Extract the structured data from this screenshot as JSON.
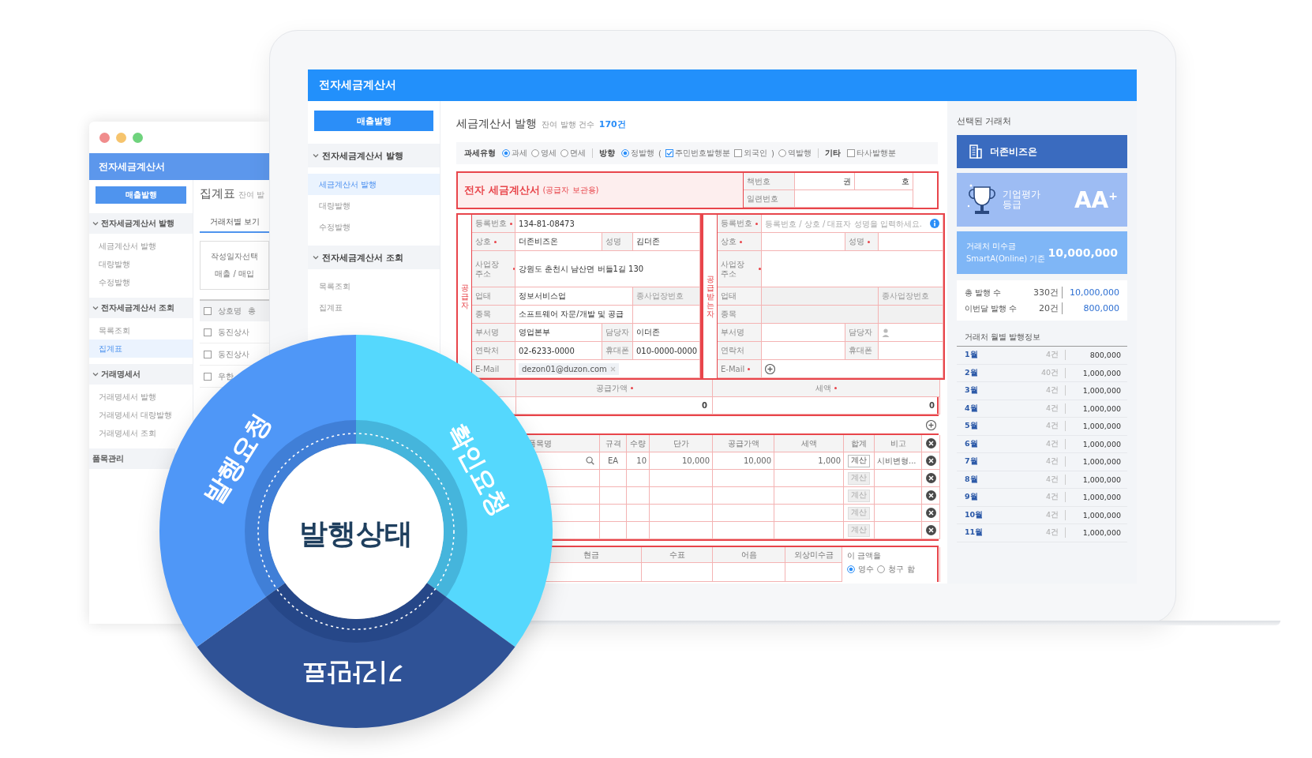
{
  "back_window": {
    "title": "전자세금계산서",
    "issue_button": "매출발행",
    "menu": [
      {
        "label": "전자세금계산서 발행",
        "expanded": true,
        "children": [
          {
            "label": "세금계산서 발행",
            "selected": false
          },
          {
            "label": "대량발행",
            "selected": false
          },
          {
            "label": "수정발행",
            "selected": false
          }
        ]
      },
      {
        "label": "전자세금계산서 조회",
        "expanded": true,
        "children": [
          {
            "label": "목록조회",
            "selected": false
          },
          {
            "label": "집계표",
            "selected": true
          }
        ]
      },
      {
        "label": "거래명세서",
        "expanded": true,
        "children": [
          {
            "label": "거래명세서 발행",
            "selected": false
          },
          {
            "label": "거래명세서 대량발행",
            "selected": false
          },
          {
            "label": "거래명세서 조회",
            "selected": false
          }
        ]
      },
      {
        "label": "품목관리"
      }
    ],
    "page_title": "집계표",
    "page_subtitle": "잔여 발",
    "tabs": [
      {
        "label": "거래처별 보기",
        "selected": true
      }
    ],
    "filter": [
      "작성일자선택",
      "매출 / 매입"
    ],
    "table": {
      "columns": [
        "상호명",
        "총"
      ],
      "header_checked": false,
      "rows": [
        {
          "checked": false,
          "name": "동진상사"
        },
        {
          "checked": false,
          "name": "동진상사"
        },
        {
          "checked": false,
          "name": "우한"
        }
      ]
    }
  },
  "main_window": {
    "title": "전자세금계산서",
    "issue_button": "매출발행",
    "menu": [
      {
        "label": "전자세금계산서 발행",
        "expanded": true,
        "children": [
          {
            "label": "세금계산서 발행",
            "selected": true
          },
          {
            "label": "대량발행",
            "selected": false
          },
          {
            "label": "수정발행",
            "selected": false
          }
        ]
      },
      {
        "label": "전자세금계산서 조회",
        "expanded": true,
        "children": [
          {
            "label": "목록조회",
            "selected": false
          },
          {
            "label": "집계표",
            "selected": false
          }
        ]
      }
    ],
    "page": {
      "title": "세금계산서 발행",
      "remaining_label": "잔여 발행 건수",
      "remaining_count": "170건"
    },
    "options": [
      {
        "label": "과세유형",
        "controls": [
          {
            "kind": "radio",
            "label": "과세",
            "selected": true
          },
          {
            "kind": "radio",
            "label": "영세",
            "selected": false
          },
          {
            "kind": "radio",
            "label": "면세",
            "selected": false
          }
        ]
      },
      {
        "label": "방향",
        "controls": [
          {
            "kind": "radio",
            "label": "정발행",
            "selected": true
          },
          {
            "kind": "text",
            "label": "("
          },
          {
            "kind": "checkbox",
            "label": "주민번호발행분",
            "checked": true
          },
          {
            "kind": "checkbox",
            "label": "외국인",
            "checked": false
          },
          {
            "kind": "text",
            "label": ")"
          },
          {
            "kind": "radio",
            "label": "역발행",
            "selected": false
          }
        ]
      },
      {
        "label": "기타",
        "controls": [
          {
            "kind": "checkbox",
            "label": "타사발행분",
            "checked": false
          }
        ]
      }
    ],
    "invoice": {
      "title": "전자 세금계산서",
      "subtitle": "(공급자 보관용)",
      "book_label": "책번호",
      "volume_unit": "권",
      "number_unit": "호",
      "serial_label": "일련번호"
    },
    "supplier": {
      "side_label": "공급자",
      "rows": [
        {
          "kind": "full",
          "label": "등록번호",
          "required": true,
          "value": "134-81-08473"
        },
        {
          "kind": "split",
          "label": "상호",
          "required": true,
          "value": "더존비즈온",
          "label2": "성명",
          "value2": "김더존"
        },
        {
          "kind": "tall",
          "label": "사업장 주소",
          "required": true,
          "value": "강원도 춘천시 남산면 버들1길 130"
        },
        {
          "kind": "wide",
          "label": "업태",
          "value": "정보서비스업",
          "label2": "종사업장번호"
        },
        {
          "kind": "wide",
          "label": "종목",
          "value": "소프트웨어 자문/개발 및 공급"
        },
        {
          "kind": "split",
          "label": "부서명",
          "value": "영업본부",
          "label2": "담당자",
          "value2": "이더존"
        },
        {
          "kind": "split",
          "label": "연락처",
          "value": "02-6233-0000",
          "label2": "휴대폰",
          "value2": "010-0000-0000"
        },
        {
          "kind": "tag",
          "label": "E-Mail",
          "value": "dezon01@duzon.com"
        }
      ]
    },
    "receiver": {
      "side_label": "공급받는자",
      "rows": [
        {
          "kind": "full",
          "label": "등록번호",
          "required": true,
          "placeholder": "등록번호 / 상호 / 대표자 성명을 입력하세요.",
          "disabled": false
        },
        {
          "kind": "split",
          "label": "상호",
          "required": true,
          "label2": "성명",
          "required2": true,
          "disabled": false
        },
        {
          "kind": "tall",
          "label": "사업장 주소",
          "required": true,
          "disabled": false
        },
        {
          "kind": "wide",
          "label": "업태",
          "label2": "종사업장번호",
          "disabled": true
        },
        {
          "kind": "wide",
          "label": "종목",
          "disabled": true
        },
        {
          "kind": "split",
          "label": "부서명",
          "label2": "담당자",
          "disabled": false
        },
        {
          "kind": "split",
          "label": "연락처",
          "label2": "휴대폰",
          "disabled": false
        },
        {
          "kind": "full",
          "label": "E-Mail",
          "required": true,
          "disabled": false
        }
      ]
    },
    "amount": {
      "columns": [
        {
          "label": "공급가액",
          "required": true
        },
        {
          "label": "세액",
          "required": true
        }
      ],
      "values": [
        "0",
        "0"
      ]
    },
    "items": {
      "columns": [
        "품목명",
        "규격",
        "수량",
        "단가",
        "공급가액",
        "세액",
        "합계",
        "비고"
      ],
      "rows": [
        {
          "kind": "filled",
          "spec": "EA",
          "qty": "10",
          "unit_price": "10,000",
          "supply": "10,000",
          "tax": "1,000",
          "calc": "계산",
          "calc_disabled": false,
          "note": "시비변형..."
        },
        {
          "kind": "empty",
          "calc": "계산",
          "calc_disabled": true
        },
        {
          "kind": "empty",
          "calc": "계산",
          "calc_disabled": true
        },
        {
          "kind": "empty",
          "calc": "계산",
          "calc_disabled": true
        },
        {
          "kind": "empty",
          "calc": "계산",
          "calc_disabled": true
        }
      ]
    },
    "payment": {
      "columns": [
        "현금",
        "수표",
        "어음",
        "외상미수금"
      ],
      "receipt_label": "이 금액을",
      "receipt_options": [
        {
          "label": "영수",
          "selected": true
        },
        {
          "label": "청구",
          "selected": false
        }
      ],
      "receipt_suffix": "함"
    },
    "partner_panel": {
      "title": "선택된 거래처",
      "partner": "더존비즈온",
      "rating_label": "기업평가 등급",
      "rating": "AA$^{+}$",
      "receivable": {
        "label": "거래처 미수금",
        "note": "SmartA(Online) 기준",
        "amount": "10,000,000"
      },
      "stats": [
        {
          "label": "총 발행 수",
          "count": "330건",
          "amount": "10,000,000"
        },
        {
          "label": "이번달 발행 수",
          "count": "20건",
          "amount": "800,000"
        }
      ],
      "monthly_title": "거래처 월별 발행정보",
      "monthly": [
        {
          "month": "1월",
          "count": "4건",
          "amount": "800,000"
        },
        {
          "month": "2월",
          "count": "40건",
          "amount": "1,000,000"
        },
        {
          "month": "3월",
          "count": "4건",
          "amount": "1,000,000"
        },
        {
          "month": "4월",
          "count": "4건",
          "amount": "1,000,000"
        },
        {
          "month": "5월",
          "count": "4건",
          "amount": "1,000,000"
        },
        {
          "month": "6월",
          "count": "4건",
          "amount": "1,000,000"
        },
        {
          "month": "7월",
          "count": "4건",
          "amount": "1,000,000"
        },
        {
          "month": "8월",
          "count": "4건",
          "amount": "1,000,000"
        },
        {
          "month": "9월",
          "count": "4건",
          "amount": "1,000,000"
        },
        {
          "month": "10월",
          "count": "4건",
          "amount": "1,000,000"
        },
        {
          "month": "11월",
          "count": "4건",
          "amount": "1,000,000"
        }
      ]
    }
  },
  "status_wheel": {
    "center": "발행상태",
    "segments": [
      {
        "label": "확인요청",
        "color": "#55d8fd"
      },
      {
        "label": "기간만료",
        "color": "#2f5296"
      },
      {
        "label": "발행요청",
        "color": "#4f97f7"
      }
    ]
  }
}
